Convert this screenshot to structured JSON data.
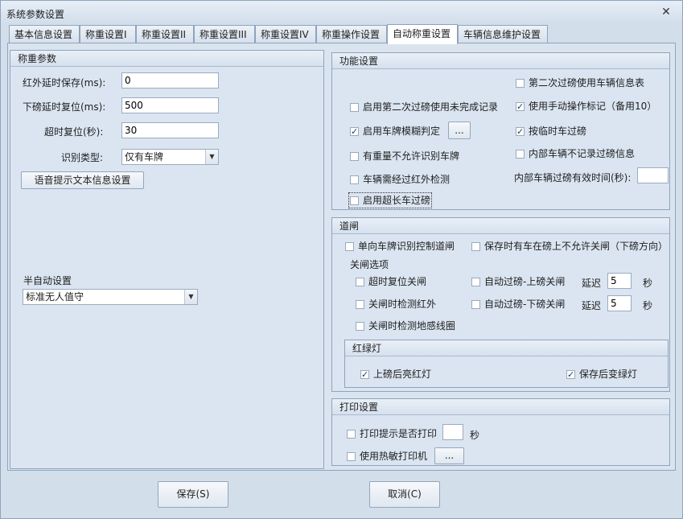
{
  "window": {
    "title": "系统参数设置",
    "close_glyph": "✕"
  },
  "tabs": [
    "基本信息设置",
    "称重设置I",
    "称重设置II",
    "称重设置III",
    "称重设置IV",
    "称重操作设置",
    "自动称重设置",
    "车辆信息维护设置"
  ],
  "weigh_params": {
    "header": "称重参数",
    "infrared_delay_label": "红外延时保存(ms):",
    "infrared_delay_value": "0",
    "off_delay_label": "下磅延时复位(ms):",
    "off_delay_value": "500",
    "timeout_label": "超时复位(秒):",
    "timeout_value": "30",
    "recog_type_label": "识别类型:",
    "recog_type_value": "仅有车牌",
    "voice_button": "语音提示文本信息设置",
    "semi_auto_label": "半自动设置",
    "semi_auto_value": "标准无人值守"
  },
  "function": {
    "header": "功能设置",
    "second_pass_vehicle_table": "第二次过磅使用车辆信息表",
    "second_pass_unfinished": "启用第二次过磅使用未完成记录",
    "manual_op_mark": "使用手动操作标记（备用10）",
    "fuzzy_plate": "启用车牌模糊判定",
    "fuzzy_button": "...",
    "temp_vehicle": "按临时车过磅",
    "no_plate_no_weigh": "有重量不允许识别车牌",
    "internal_no_record": "内部车辆不记录过磅信息",
    "infrared_check": "车辆需经过红外检测",
    "internal_valid_time": "内部车辆过磅有效时间(秒):",
    "internal_valid_value": "",
    "long_vehicle": "启用超长车过磅"
  },
  "gate": {
    "header": "道闸",
    "single_plate_control": "单向车牌识别控制道闸",
    "save_no_close": "保存时有车在磅上不允许关闸（下磅方向）",
    "close_options": "关闸选项",
    "timeout_close": "超时复位关闸",
    "auto_on_close": "自动过磅-上磅关闸",
    "delay1_label": "延迟",
    "delay1_value": "5",
    "delay1_unit": "秒",
    "infrared_close": "关闸时检测红外",
    "auto_off_close": "自动过磅-下磅关闸",
    "delay2_label": "延迟",
    "delay2_value": "5",
    "delay2_unit": "秒",
    "ground_coil": "关闸时检测地感线圈",
    "traffic_light": {
      "header": "红绿灯",
      "red_on_enter": "上磅后亮红灯",
      "green_on_save": "保存后变绿灯"
    }
  },
  "print": {
    "header": "打印设置",
    "prompt_print": "打印提示是否打印",
    "prompt_value": "",
    "prompt_unit": "秒",
    "thermal": "使用热敏打印机",
    "thermal_button": "..."
  },
  "footer": {
    "save": "保存(S)",
    "cancel": "取消(C)"
  }
}
